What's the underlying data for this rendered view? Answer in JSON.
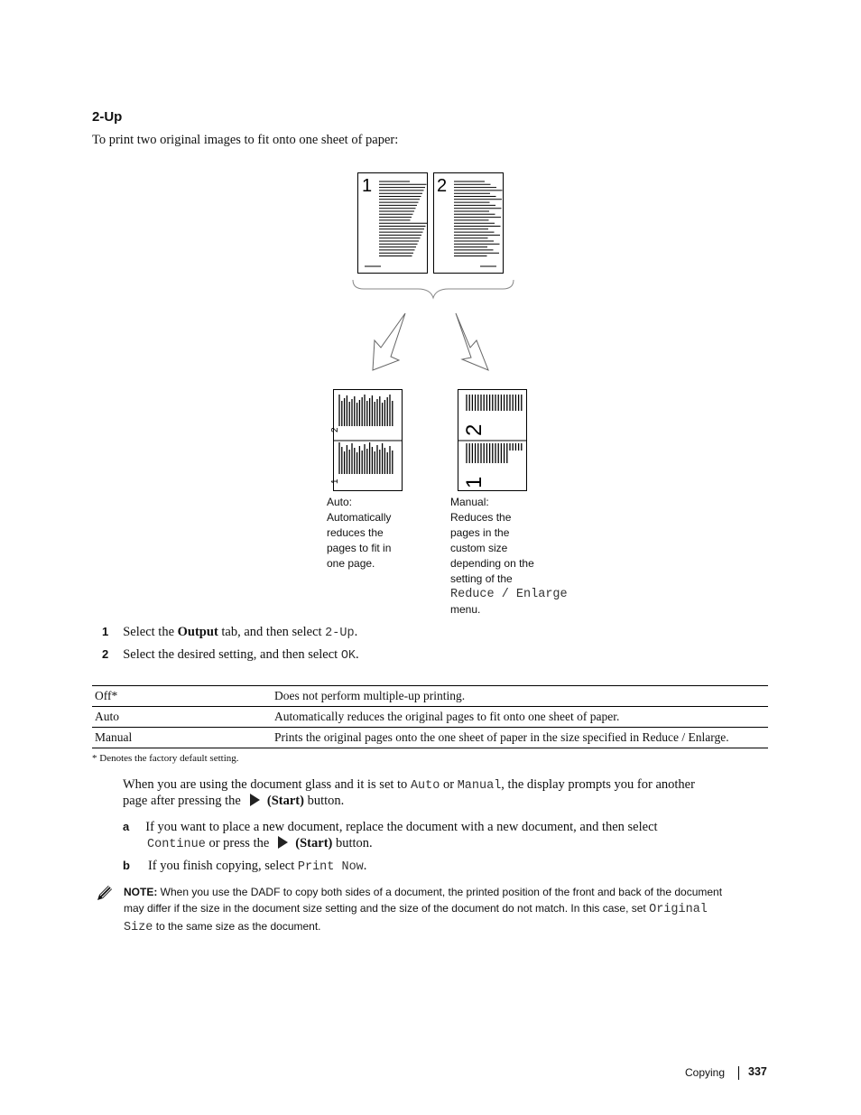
{
  "section_title": "2-Up",
  "intro": "To print two original images to fit onto one sheet of paper:",
  "diagram": {
    "source_page_numbers": [
      "1",
      "2"
    ],
    "auto_caption": [
      "Auto:",
      "Automatically",
      "reduces the",
      "pages to fit in",
      "one page."
    ],
    "manual_caption": [
      "Manual:",
      "Reduces the",
      "pages in the",
      "custom size",
      "depending on the",
      "setting of the"
    ],
    "manual_caption_code": "Reduce / Enlarge",
    "manual_caption_end": "menu."
  },
  "steps": [
    {
      "num": "1",
      "pre": "Select the ",
      "bold": "Output",
      "mid": " tab, and then select ",
      "code": "2-Up",
      "post": "."
    },
    {
      "num": "2",
      "pre": "Select the desired setting, and then select ",
      "code": "OK",
      "post": "."
    }
  ],
  "table": {
    "rows": [
      {
        "setting": "Off*",
        "description": "Does not perform multiple-up printing."
      },
      {
        "setting": "Auto",
        "description": "Automatically reduces the original pages to fit onto one sheet of paper."
      },
      {
        "setting": "Manual",
        "description": "Prints the original pages onto the one sheet of paper in the size specified in Reduce / Enlarge."
      }
    ],
    "footnote": "* Denotes the factory default setting."
  },
  "para": {
    "t1": "When you are using the document glass and it is set to ",
    "c1": "Auto",
    "t2": " or ",
    "c2": "Manual",
    "t3": ", the display prompts you for another",
    "t4": "page after pressing the",
    "start": "(Start)",
    "t5": " button."
  },
  "substeps": [
    {
      "letter": "a",
      "t1": "If you want to place a new document, replace the document with a new document, and then select",
      "code": "Continue",
      "t2": " or press the",
      "start": "(Start)",
      "t3": " button."
    },
    {
      "letter": "b",
      "t1": "If you finish copying, select ",
      "code": "Print Now",
      "t2": "."
    }
  ],
  "note": {
    "label": "NOTE:",
    "t1": " When you use the DADF to copy both sides of a document, the printed position of the front and back of the document",
    "t2": "may differ if the size in the document size setting and the size of the document do not match. In this case, set ",
    "code1": "Original",
    "code2": "Size",
    "t3": " to the same size as the document."
  },
  "footer": {
    "section": "Copying",
    "page": "337"
  }
}
